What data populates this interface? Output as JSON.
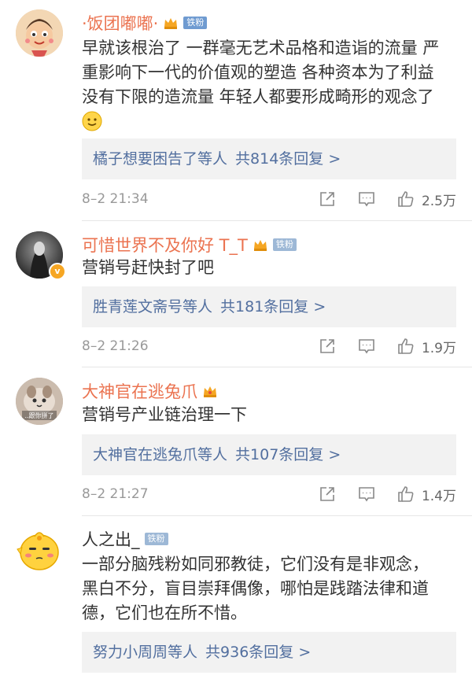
{
  "comments": [
    {
      "username": "·饭团嘟嘟·",
      "badge": "铁粉",
      "text_lines": [
        "早就该根治了 一群毫无艺术品格和造诣的流量 严",
        "重影响下一代的价值观的塑造 各种资本为了利益",
        "没有下限的造流量 年轻人都要形成畸形的观念了"
      ],
      "emoji": "smile",
      "replies": {
        "names": "橘子想要困告了等人",
        "count": "共814条回复 >"
      },
      "time": "8–2 21:34",
      "likes": "2.5万"
    },
    {
      "username": "可惜世界不及你好 T_T",
      "badge": "铁粉",
      "text_lines": [
        "营销号赶快封了吧"
      ],
      "replies": {
        "names": "胜青莲文斋号等人",
        "count": "共181条回复 >"
      },
      "time": "8–2 21:26",
      "likes": "1.9万"
    },
    {
      "username": "大神官在逃兔爪",
      "text_lines": [
        "营销号产业链治理一下"
      ],
      "avatar_caption": "..跟你拼了",
      "replies": {
        "names": "大神官在逃兔爪等人",
        "count": "共107条回复 >"
      },
      "time": "8–2 21:27",
      "likes": "1.4万"
    },
    {
      "username": "人之出_",
      "badge": "铁粉",
      "text_lines": [
        "一部分脑残粉如同邪教徒，它们没有是非观念，",
        "黑白不分，盲目崇拜偶像，哪怕是践踏法律和道",
        "德，它们也在所不惜。"
      ],
      "replies": {
        "names": "努力小周周等人",
        "count": "共936条回复 >"
      }
    }
  ],
  "colors": {
    "username": "#eb7350",
    "link": "#526f9f",
    "reply_bg": "#f2f2f2",
    "meta": "#999999"
  },
  "icons": [
    "crown-icon",
    "share-icon",
    "comment-icon",
    "like-icon",
    "verified-icon"
  ]
}
